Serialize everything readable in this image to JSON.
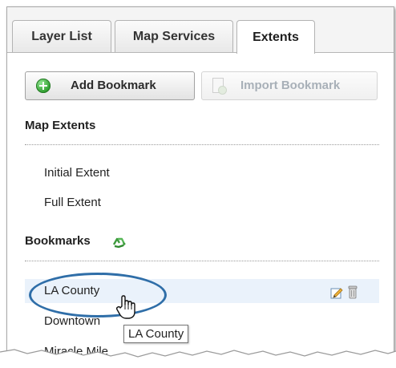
{
  "tabs": [
    {
      "label": "Layer List"
    },
    {
      "label": "Map Services"
    },
    {
      "label": "Extents"
    }
  ],
  "active_tab": "Extents",
  "toolbar": {
    "add_bookmark_label": "Add Bookmark",
    "import_bookmark_label": "Import Bookmark"
  },
  "map_extents": {
    "title": "Map Extents",
    "items": [
      {
        "label": "Initial Extent"
      },
      {
        "label": "Full Extent"
      }
    ]
  },
  "bookmarks": {
    "title": "Bookmarks",
    "title_icon": "recycle-icon",
    "items": [
      {
        "label": "LA County",
        "hovered": true,
        "row_icons": [
          "edit-icon",
          "delete-icon"
        ]
      },
      {
        "label": "Downtown"
      },
      {
        "label": "Miracle Mile"
      }
    ]
  },
  "tooltip": {
    "text": "LA County"
  },
  "colors": {
    "highlight_row": "#eaf2fb",
    "annotation_oval": "#2f6ea8",
    "add_icon_green": "#2f9e2f",
    "disabled_text": "#a8b0b8"
  }
}
